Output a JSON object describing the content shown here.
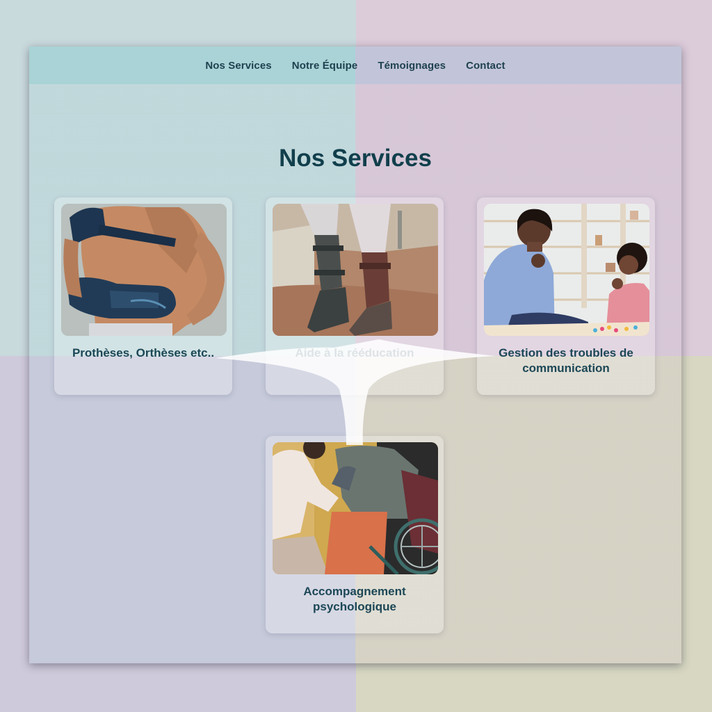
{
  "nav": {
    "items": [
      {
        "label": "Nos Services"
      },
      {
        "label": "Notre Équipe"
      },
      {
        "label": "Témoignages"
      },
      {
        "label": "Contact"
      }
    ]
  },
  "main": {
    "title": "Nos Services",
    "services": [
      {
        "label": "Prothèses, Orthèses etc..",
        "image": "shoulder-brace-photo"
      },
      {
        "label": "Aide à la rééducation",
        "image": "leg-braces-photo"
      },
      {
        "label": "Gestion des troubles de communication",
        "image": "therapist-child-photo"
      },
      {
        "label": "Accompagnement psychologique",
        "image": "wheelchair-support-photo"
      }
    ]
  },
  "colors": {
    "title": "#113f4c",
    "nav_text": "#1f4150",
    "card_text": "#1c4756"
  }
}
